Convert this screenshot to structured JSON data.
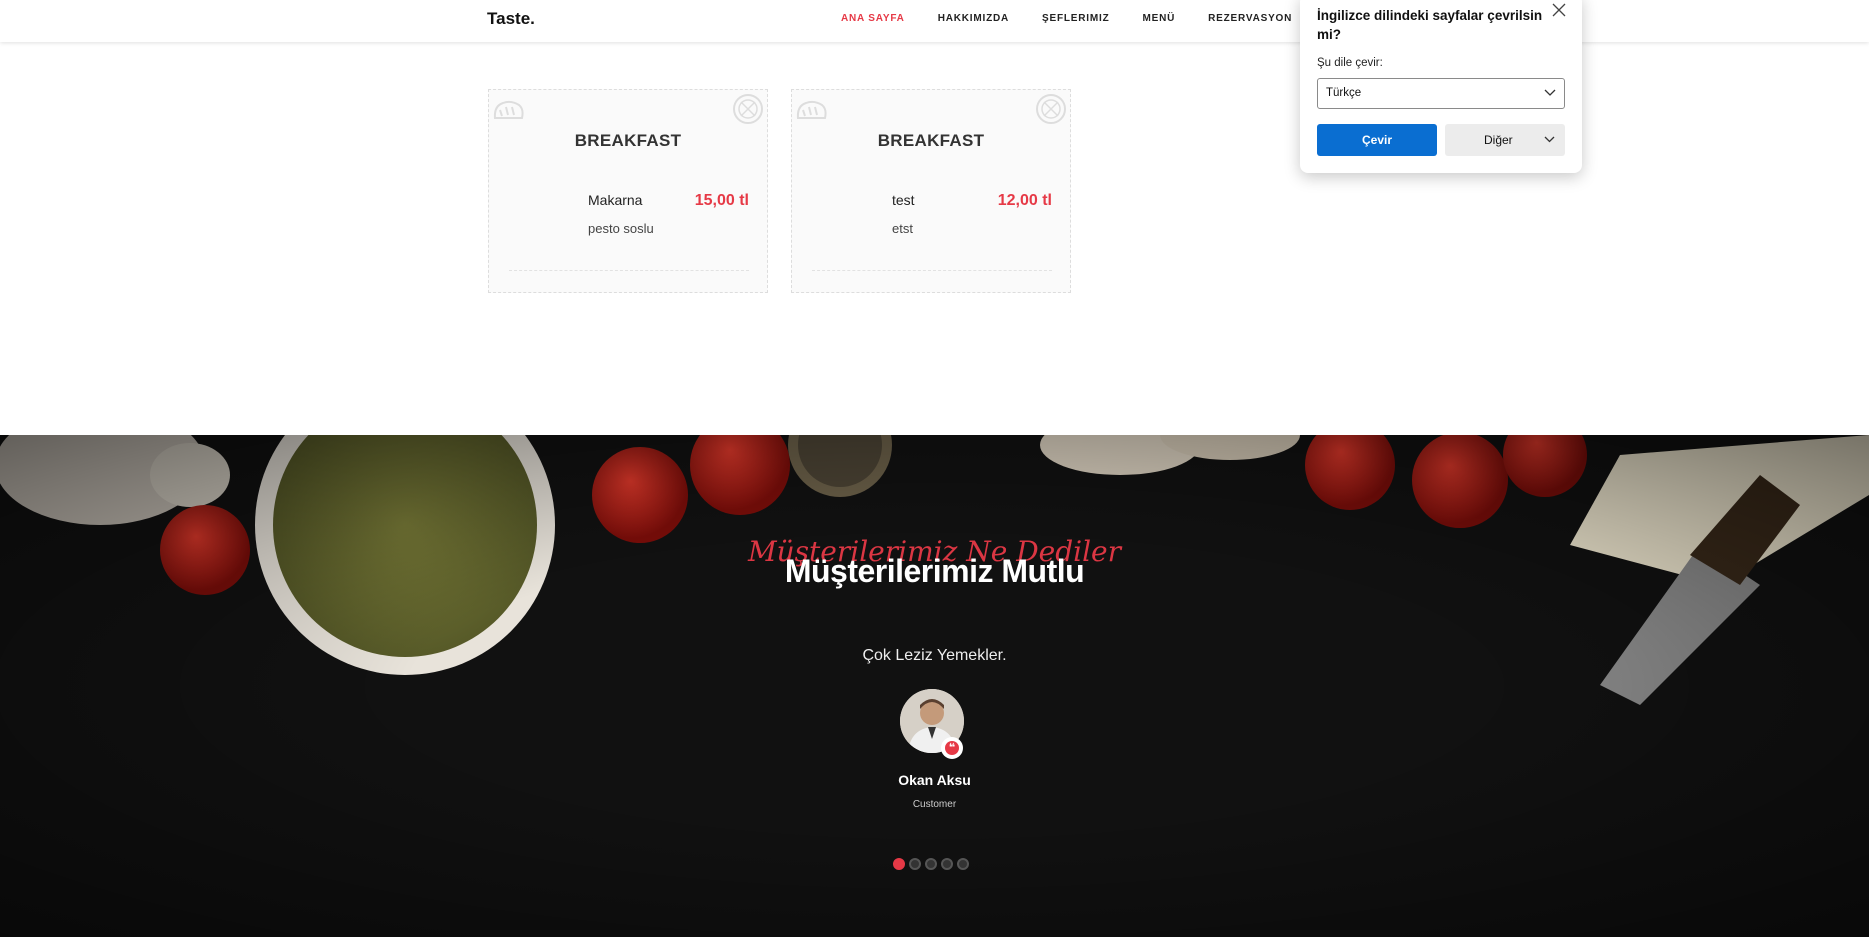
{
  "header": {
    "logo": "Taste.",
    "nav": [
      "ANA SAYFA",
      "HAKKIMIZDA",
      "ŞEFLERIMIZ",
      "MENÜ",
      "REZERVASYON"
    ]
  },
  "menu_cards": [
    {
      "title": "BREAKFAST",
      "item": "Makarna",
      "description": "pesto soslu",
      "price": "15,00 tl"
    },
    {
      "title": "BREAKFAST",
      "item": "test",
      "description": "etst",
      "price": "12,00 tl"
    }
  ],
  "testimonials": {
    "script_title": "Müşterilerimiz Ne Dediler",
    "title": "Müşterilerimiz Mutlu",
    "quote": "Çok Leziz Yemekler.",
    "name": "Okan Aksu",
    "role": "Customer",
    "quote_icon": "❝",
    "slides": 5,
    "active_slide": 1
  },
  "translate_popup": {
    "title": "İngilizce dilindeki sayfalar çevrilsin mi?",
    "label": "Şu dile çevir:",
    "selected_language": "Türkçe",
    "translate_button": "Çevir",
    "other_button": "Diğer"
  },
  "colors": {
    "accent": "#e63946",
    "popup_primary": "#0a6ed1"
  }
}
